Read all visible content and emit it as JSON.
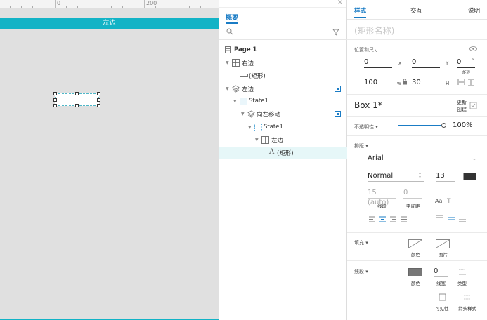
{
  "canvas": {
    "ruler_labels": [
      "0",
      "200"
    ],
    "banner_text": "左边"
  },
  "outline": {
    "tab_label": "概要",
    "search_placeholder": "",
    "items": [
      {
        "label": "Page 1",
        "icon": "page-icon"
      },
      {
        "label": "右边",
        "icon": "dynamic-panel-icon"
      },
      {
        "label": "(矩形)",
        "icon": "rectangle-line-icon"
      },
      {
        "label": "左边",
        "icon": "layers-icon"
      },
      {
        "label": "State1",
        "icon": "state-icon"
      },
      {
        "label": "向左移动",
        "icon": "layers-icon"
      },
      {
        "label": "State1",
        "icon": "state-dashed-icon"
      },
      {
        "label": "左边",
        "icon": "dynamic-panel-icon"
      },
      {
        "label": "(矩形)",
        "icon": "text-a-icon"
      }
    ]
  },
  "props": {
    "tabs": [
      "样式",
      "交互",
      "说明"
    ],
    "shape_name_placeholder": "(矩形名称)",
    "position_size_label": "位置和尺寸",
    "x_value": "0",
    "x_unit": "x",
    "y_value": "0",
    "y_unit": "Y",
    "rotate_value": "0",
    "rotate_unit": "°",
    "rotate_label": "旋转",
    "w_value": "100",
    "w_unit": "w",
    "h_value": "30",
    "h_unit": "H",
    "box_name": "Box 1*",
    "update_label_1": "更新",
    "update_label_2": "创建",
    "opacity_label": "不透明性 ▾",
    "opacity_value": "100%",
    "typography_label": "排版 ▾",
    "font_family": "Arial",
    "font_weight": "Normal",
    "font_size": "13",
    "line_height_value": "15 (auto)",
    "line_height_label": "线段",
    "char_spacing_value": "0",
    "char_spacing_label": "字间距",
    "fill_label": "填充 ▾",
    "fill_color_label": "颜色",
    "fill_image_label": "图片",
    "border_label": "线段 ▾",
    "border_color_label": "颜色",
    "border_width_value": "0",
    "border_width_label": "线宽",
    "border_type_label": "类型",
    "visibility_label": "可见性",
    "arrow_style_label": "箭头样式"
  },
  "colors": {
    "accent": "#1a7cc5",
    "banner": "#12b3c6",
    "font_color": "#333333",
    "border_color": "#888888"
  }
}
